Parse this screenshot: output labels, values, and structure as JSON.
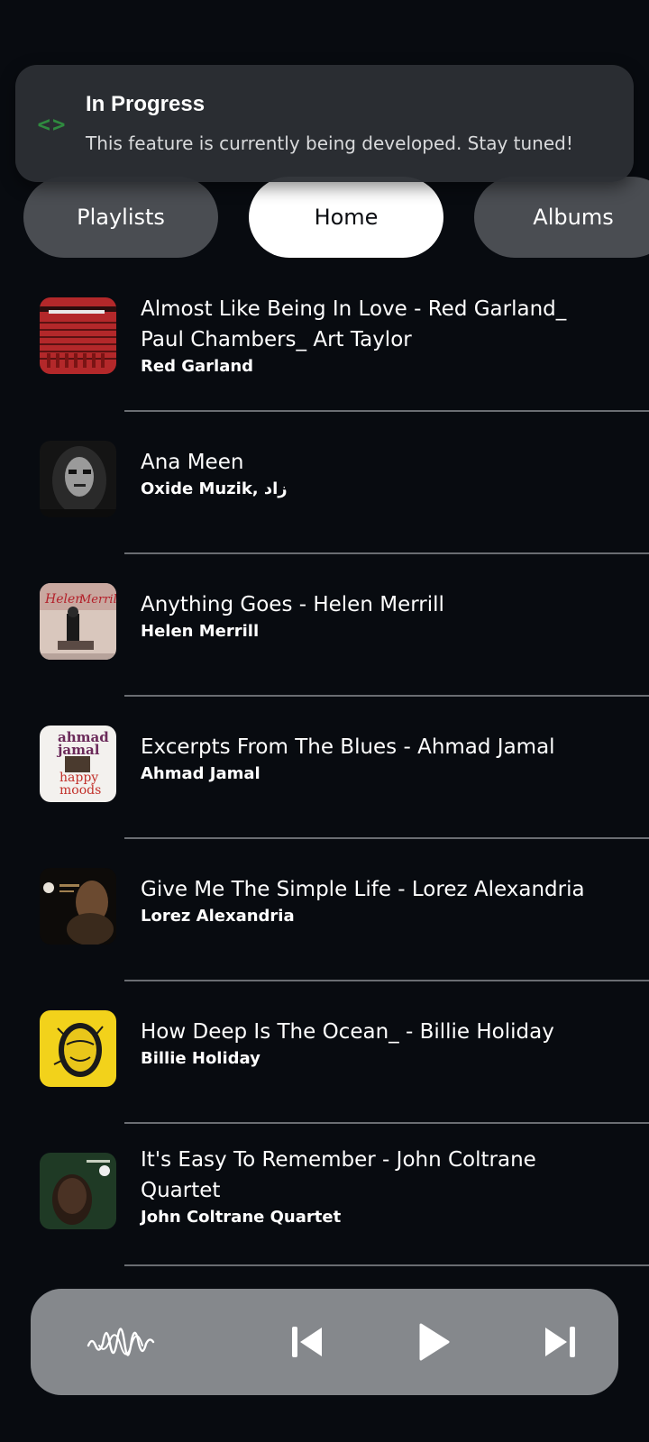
{
  "toast": {
    "title": "In Progress",
    "message": "This feature is currently being developed. Stay tuned!",
    "icon": "code-icon"
  },
  "tabs": [
    {
      "label": "Playlists"
    },
    {
      "label": "Home",
      "active": true
    },
    {
      "label": "Albums"
    }
  ],
  "tracks": [
    {
      "title": "Almost Like Being In Love - Red Garland_ Paul Chambers_ Art Taylor",
      "artist": "Red Garland"
    },
    {
      "title": "Ana Meen",
      "artist": "Oxide Muzik, زاد"
    },
    {
      "title": "Anything Goes - Helen Merrill",
      "artist": "Helen Merrill"
    },
    {
      "title": "Excerpts From The Blues - Ahmad Jamal",
      "artist": "Ahmad Jamal"
    },
    {
      "title": "Give Me The Simple Life - Lorez Alexandria",
      "artist": "Lorez Alexandria"
    },
    {
      "title": "How Deep Is The Ocean_ - Billie Holiday",
      "artist": "Billie Holiday"
    },
    {
      "title": "It's Easy To Remember - John Coltrane Quartet",
      "artist": "John Coltrane Quartet"
    }
  ],
  "covers": {
    "c3": {
      "line1": "ahmad",
      "line2": "jamal",
      "line3": "happy",
      "line4": "moods"
    }
  },
  "player": {
    "icons": [
      "waveform-icon",
      "skip-previous-icon",
      "play-icon",
      "skip-next-icon"
    ]
  },
  "colors": {
    "background": "#080b10",
    "tab_inactive": "#4a4d52",
    "tab_active": "#ffffff",
    "toast_bg": "#2c2f34",
    "player_bg": "#85888c",
    "code_icon": "#2f8a3f",
    "divider": "#6a6d72"
  }
}
